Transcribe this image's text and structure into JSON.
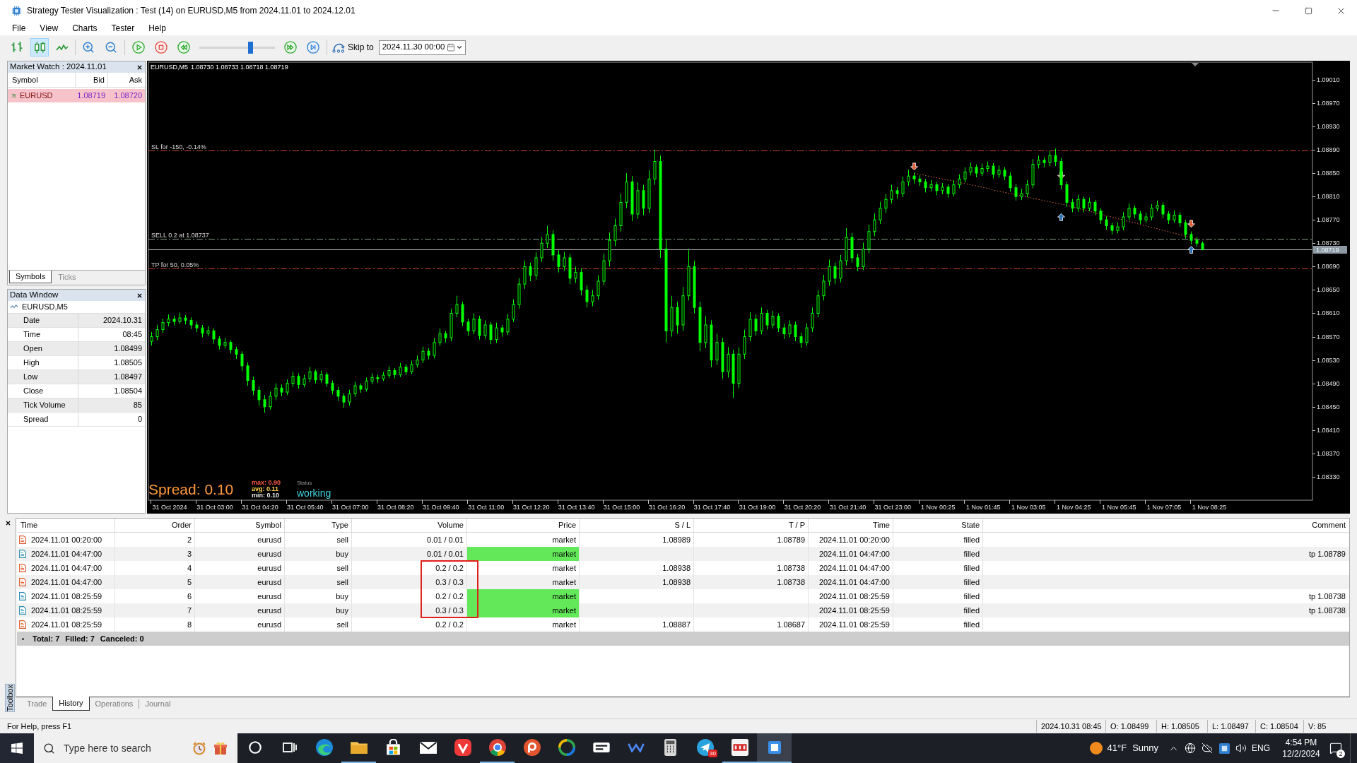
{
  "window": {
    "title": "Strategy Tester Visualization : Test (14) on EURUSD,M5 from 2024.11.01 to 2024.12.01"
  },
  "menu": [
    "File",
    "View",
    "Charts",
    "Tester",
    "Help"
  ],
  "toolbar": {
    "chart_types": [
      {
        "kind": "bars",
        "selected": false
      },
      {
        "kind": "candles",
        "selected": true
      },
      {
        "kind": "line",
        "selected": false
      }
    ],
    "speed": {
      "level": 0.67
    },
    "skip_label": "Skip to",
    "skip_date": "2024.11.30 00:00"
  },
  "market_watch": {
    "title": "Market Watch : 2024.11.01",
    "columns": [
      "Symbol",
      "Bid",
      "Ask"
    ],
    "rows": [
      {
        "symbol": "EURUSD",
        "bid": "1.08719",
        "ask": "1.08720"
      }
    ],
    "tabs": [
      {
        "label": "Symbols",
        "selected": true
      },
      {
        "label": "Ticks",
        "selected": false
      }
    ]
  },
  "data_window": {
    "title": "Data Window",
    "symbol": "EURUSD,M5",
    "rows": [
      {
        "label": "Date",
        "value": "2024.10.31"
      },
      {
        "label": "Time",
        "value": "08:45"
      },
      {
        "label": "Open",
        "value": "1.08499"
      },
      {
        "label": "High",
        "value": "1.08505"
      },
      {
        "label": "Low",
        "value": "1.08497"
      },
      {
        "label": "Close",
        "value": "1.08504"
      },
      {
        "label": "Tick Volume",
        "value": "85"
      },
      {
        "label": "Spread",
        "value": "0"
      }
    ]
  },
  "chart": {
    "header": {
      "symbol": "EURUSD,M5",
      "prices": "1.08730 1.08733 1.08718 1.08719"
    },
    "overlay": {
      "spread": "Spread: 0.10",
      "stats": [
        {
          "text": "max: 0.90",
          "color": "#ff5a4a"
        },
        {
          "text": "avg: 0.11",
          "color": "#ffd24a"
        },
        {
          "text": "min: 0.10",
          "color": "#e8e8e8"
        }
      ],
      "status_label": "Status",
      "status": "working"
    },
    "chart_data": [
      {
        "type": "candlestick",
        "color": "#00ff00",
        "categories": [
          null,
          null,
          null,
          "31 Oct 2024",
          null,
          null,
          null,
          null,
          null,
          null,
          null,
          "31 Oct 03:00",
          null,
          null,
          null,
          null,
          null,
          null,
          null,
          "31 Oct 04:20",
          null,
          null,
          null,
          null,
          null,
          null,
          null,
          "31 Oct 05:40",
          null,
          null,
          null,
          null,
          null,
          null,
          null,
          "31 Oct 07:00",
          null,
          null,
          null,
          null,
          null,
          null,
          null,
          "31 Oct 08:20",
          null,
          null,
          null,
          null,
          null,
          null,
          null,
          "31 Oct 09:40",
          null,
          null,
          null,
          null,
          null,
          null,
          null,
          "31 Oct 11:00",
          null,
          null,
          null,
          null,
          null,
          null,
          null,
          "31 Oct 12:20",
          null,
          null,
          null,
          null,
          null,
          null,
          null,
          "31 Oct 13:40",
          null,
          null,
          null,
          null,
          null,
          null,
          null,
          "31 Oct 15:00",
          null,
          null,
          null,
          null,
          null,
          null,
          null,
          "31 Oct 16:20",
          null,
          null,
          null,
          null,
          null,
          null,
          null,
          "31 Oct 17:40",
          null,
          null,
          null,
          null,
          null,
          null,
          null,
          "31 Oct 19:00",
          null,
          null,
          null,
          null,
          null,
          null,
          null,
          "31 Oct 20:20",
          null,
          null,
          null,
          null,
          null,
          null,
          null,
          "31 Oct 21:40",
          null,
          null,
          null,
          null,
          null,
          null,
          null,
          "31 Oct 23:00",
          null,
          null,
          null,
          null,
          null,
          null,
          null,
          "1 Nov 00:25",
          null,
          null,
          null,
          null,
          null,
          null,
          null,
          "1 Nov 01:45",
          null,
          null,
          null,
          null,
          null,
          null,
          null,
          "1 Nov 03:05",
          null,
          null,
          null,
          null,
          null,
          null,
          null,
          "1 Nov 04:25",
          null,
          null,
          null,
          null,
          null,
          null,
          null,
          "1 Nov 05:45",
          null,
          null,
          null,
          null,
          null,
          null,
          null,
          "1 Nov 07:05",
          null,
          null,
          null,
          null,
          null,
          null,
          null,
          "1 Nov 08:25",
          null,
          null,
          null,
          null,
          null,
          null,
          null,
          null,
          null,
          null,
          null,
          null,
          null,
          null,
          null,
          null,
          null,
          null
        ],
        "ohlc": [
          [
            1.08562,
            1.08578,
            1.08555,
            1.0857
          ],
          [
            1.0857,
            1.0859,
            1.08564,
            1.08582
          ],
          [
            1.08582,
            1.08601,
            1.08576,
            1.08594
          ],
          [
            1.08594,
            1.08608,
            1.08588,
            1.086
          ],
          [
            1.086,
            1.08606,
            1.08589,
            1.08596
          ],
          [
            1.08596,
            1.08611,
            1.08592,
            1.08602
          ],
          [
            1.08602,
            1.08607,
            1.08591,
            1.08598
          ],
          [
            1.08598,
            1.08603,
            1.08583,
            1.0859
          ],
          [
            1.0859,
            1.08596,
            1.08578,
            1.08585
          ],
          [
            1.08585,
            1.0859,
            1.08569,
            1.08576
          ],
          [
            1.08576,
            1.08588,
            1.08571,
            1.0858
          ],
          [
            1.0858,
            1.08584,
            1.08558,
            1.08566
          ],
          [
            1.08566,
            1.08571,
            1.08548,
            1.08555
          ],
          [
            1.08555,
            1.08568,
            1.0855,
            1.0856
          ],
          [
            1.0856,
            1.08564,
            1.08541,
            1.08548
          ],
          [
            1.08548,
            1.08553,
            1.08532,
            1.0854
          ],
          [
            1.0854,
            1.08545,
            1.08511,
            1.0852
          ],
          [
            1.0852,
            1.08526,
            1.08486,
            1.08495
          ],
          [
            1.08495,
            1.08502,
            1.0847,
            1.08478
          ],
          [
            1.08478,
            1.08485,
            1.08452,
            1.08462
          ],
          [
            1.08462,
            1.0847,
            1.0844,
            1.0845
          ],
          [
            1.0845,
            1.08476,
            1.08445,
            1.08468
          ],
          [
            1.08468,
            1.0849,
            1.08461,
            1.08482
          ],
          [
            1.08482,
            1.08488,
            1.08468,
            1.08475
          ],
          [
            1.08475,
            1.08497,
            1.0847,
            1.0849
          ],
          [
            1.0849,
            1.0851,
            1.08484,
            1.08502
          ],
          [
            1.08502,
            1.08507,
            1.08481,
            1.08488
          ],
          [
            1.08488,
            1.08505,
            1.08483,
            1.08498
          ],
          [
            1.08498,
            1.08518,
            1.08492,
            1.0851
          ],
          [
            1.0851,
            1.08514,
            1.0849,
            1.08496
          ],
          [
            1.08496,
            1.08512,
            1.08491,
            1.08505
          ],
          [
            1.08505,
            1.08509,
            1.08484,
            1.0849
          ],
          [
            1.0849,
            1.08495,
            1.08471,
            1.08478
          ],
          [
            1.08478,
            1.08484,
            1.0846,
            1.08468
          ],
          [
            1.08468,
            1.08473,
            1.08448,
            1.08458
          ],
          [
            1.08458,
            1.08479,
            1.08452,
            1.08472
          ],
          [
            1.08472,
            1.08493,
            1.08467,
            1.08486
          ],
          [
            1.08486,
            1.0849,
            1.08474,
            1.0848
          ],
          [
            1.0848,
            1.085,
            1.08476,
            1.08494
          ],
          [
            1.08494,
            1.08507,
            1.08489,
            1.085
          ],
          [
            1.085,
            1.08505,
            1.08491,
            1.08498
          ],
          [
            1.08498,
            1.0851,
            1.08494,
            1.08504
          ],
          [
            1.08504,
            1.08519,
            1.08499,
            1.08512
          ],
          [
            1.08512,
            1.08516,
            1.08499,
            1.08505
          ],
          [
            1.08505,
            1.08525,
            1.08501,
            1.08518
          ],
          [
            1.08518,
            1.08523,
            1.08504,
            1.0851
          ],
          [
            1.0851,
            1.08529,
            1.08506,
            1.08522
          ],
          [
            1.08522,
            1.08538,
            1.08517,
            1.0853
          ],
          [
            1.0853,
            1.08553,
            1.08525,
            1.08545
          ],
          [
            1.08545,
            1.0855,
            1.08531,
            1.08538
          ],
          [
            1.08538,
            1.08568,
            1.08533,
            1.0856
          ],
          [
            1.0856,
            1.08584,
            1.08554,
            1.08575
          ],
          [
            1.08575,
            1.0858,
            1.0856,
            1.08568
          ],
          [
            1.08568,
            1.08618,
            1.08562,
            1.0861
          ],
          [
            1.0861,
            1.0864,
            1.08603,
            1.08625
          ],
          [
            1.08625,
            1.0863,
            1.08588,
            1.08595
          ],
          [
            1.08595,
            1.08601,
            1.08572,
            1.0858
          ],
          [
            1.0858,
            1.0861,
            1.08574,
            1.086
          ],
          [
            1.086,
            1.08606,
            1.08565,
            1.08572
          ],
          [
            1.08572,
            1.08598,
            1.08566,
            1.0859
          ],
          [
            1.0859,
            1.08595,
            1.08557,
            1.08565
          ],
          [
            1.08565,
            1.08594,
            1.08559,
            1.08585
          ],
          [
            1.08585,
            1.0859,
            1.0857,
            1.08578
          ],
          [
            1.08578,
            1.08609,
            1.08573,
            1.086
          ],
          [
            1.086,
            1.08634,
            1.08595,
            1.08625
          ],
          [
            1.08625,
            1.0867,
            1.08618,
            1.0866
          ],
          [
            1.0866,
            1.087,
            1.08652,
            1.0869
          ],
          [
            1.0869,
            1.08697,
            1.08665,
            1.08675
          ],
          [
            1.08675,
            1.08714,
            1.08668,
            1.08705
          ],
          [
            1.08705,
            1.0874,
            1.08698,
            1.0873
          ],
          [
            1.0873,
            1.0876,
            1.08722,
            1.08745
          ],
          [
            1.08745,
            1.08752,
            1.087,
            1.0871
          ],
          [
            1.0871,
            1.08718,
            1.0868,
            1.0869
          ],
          [
            1.0869,
            1.08715,
            1.08683,
            1.08705
          ],
          [
            1.08705,
            1.08712,
            1.0866,
            1.0867
          ],
          [
            1.0867,
            1.0869,
            1.08662,
            1.0868
          ],
          [
            1.0868,
            1.08687,
            1.08641,
            1.0865
          ],
          [
            1.0865,
            1.08658,
            1.0862,
            1.0863
          ],
          [
            1.0863,
            1.0865,
            1.08622,
            1.0864
          ],
          [
            1.0864,
            1.08675,
            1.08633,
            1.08665
          ],
          [
            1.08665,
            1.08712,
            1.08658,
            1.087
          ],
          [
            1.087,
            1.08748,
            1.0869,
            1.08735
          ],
          [
            1.08735,
            1.08772,
            1.08725,
            1.0876
          ],
          [
            1.0876,
            1.08815,
            1.0875,
            1.088
          ],
          [
            1.088,
            1.0885,
            1.0879,
            1.08835
          ],
          [
            1.08835,
            1.08845,
            1.08768,
            1.0878
          ],
          [
            1.0878,
            1.08834,
            1.08772,
            1.0882
          ],
          [
            1.0882,
            1.0883,
            1.08778,
            1.0879
          ],
          [
            1.0879,
            1.08855,
            1.08782,
            1.0884
          ],
          [
            1.0884,
            1.0889,
            1.0883,
            1.0887
          ],
          [
            1.0887,
            1.0888,
            1.08705,
            1.0872
          ],
          [
            1.0872,
            1.08735,
            1.0856,
            1.0858
          ],
          [
            1.0858,
            1.0864,
            1.0857,
            1.0862
          ],
          [
            1.0862,
            1.0863,
            1.08575,
            1.0859
          ],
          [
            1.0859,
            1.08655,
            1.0858,
            1.0864
          ],
          [
            1.0864,
            1.0872,
            1.08632,
            1.0869
          ],
          [
            1.0869,
            1.087,
            1.0861,
            1.0862
          ],
          [
            1.0862,
            1.0863,
            1.08545,
            1.0856
          ],
          [
            1.0856,
            1.08605,
            1.0855,
            1.0859
          ],
          [
            1.0859,
            1.08598,
            1.08518,
            1.0853
          ],
          [
            1.0853,
            1.08575,
            1.08522,
            1.0856
          ],
          [
            1.0856,
            1.08568,
            1.08498,
            1.0851
          ],
          [
            1.0851,
            1.08552,
            1.085,
            1.0854
          ],
          [
            1.0854,
            1.08548,
            1.08465,
            1.0849
          ],
          [
            1.0849,
            1.08552,
            1.08482,
            1.0854
          ],
          [
            1.0854,
            1.08582,
            1.08532,
            1.0857
          ],
          [
            1.0857,
            1.08612,
            1.08562,
            1.086
          ],
          [
            1.086,
            1.08608,
            1.08572,
            1.0858
          ],
          [
            1.0858,
            1.0862,
            1.08574,
            1.0861
          ],
          [
            1.0861,
            1.08616,
            1.08582,
            1.0859
          ],
          [
            1.0859,
            1.08614,
            1.08584,
            1.08605
          ],
          [
            1.08605,
            1.0861,
            1.08578,
            1.08585
          ],
          [
            1.08585,
            1.08592,
            1.08566,
            1.08575
          ],
          [
            1.08575,
            1.08598,
            1.08569,
            1.0859
          ],
          [
            1.0859,
            1.08596,
            1.08562,
            1.0857
          ],
          [
            1.0857,
            1.08577,
            1.08551,
            1.0856
          ],
          [
            1.0856,
            1.08593,
            1.08554,
            1.08585
          ],
          [
            1.08585,
            1.0862,
            1.08578,
            1.0861
          ],
          [
            1.0861,
            1.0865,
            1.08603,
            1.0864
          ],
          [
            1.0864,
            1.08676,
            1.08632,
            1.08665
          ],
          [
            1.08665,
            1.08702,
            1.08657,
            1.0869
          ],
          [
            1.0869,
            1.08697,
            1.0866,
            1.0867
          ],
          [
            1.0867,
            1.0871,
            1.08663,
            1.087
          ],
          [
            1.087,
            1.08756,
            1.08692,
            1.0874
          ],
          [
            1.0874,
            1.08748,
            1.08697,
            1.08705
          ],
          [
            1.08705,
            1.08712,
            1.08682,
            1.0869
          ],
          [
            1.0869,
            1.08731,
            1.08684,
            1.0872
          ],
          [
            1.0872,
            1.08762,
            1.08713,
            1.0875
          ],
          [
            1.0875,
            1.08781,
            1.08742,
            1.0877
          ],
          [
            1.0877,
            1.08801,
            1.08763,
            1.0879
          ],
          [
            1.0879,
            1.08814,
            1.08782,
            1.08805
          ],
          [
            1.08805,
            1.0883,
            1.08798,
            1.0882
          ],
          [
            1.0882,
            1.08826,
            1.08806,
            1.08815
          ],
          [
            1.08815,
            1.08844,
            1.08809,
            1.08835
          ],
          [
            1.08835,
            1.08856,
            1.08828,
            1.08845
          ],
          [
            1.08845,
            1.08851,
            1.08832,
            1.0884
          ],
          [
            1.0884,
            1.08846,
            1.08828,
            1.08835
          ],
          [
            1.08835,
            1.0884,
            1.08817,
            1.08825
          ],
          [
            1.08825,
            1.08838,
            1.08819,
            1.0883
          ],
          [
            1.0883,
            1.08835,
            1.08812,
            1.0882
          ],
          [
            1.0882,
            1.08833,
            1.08814,
            1.08826
          ],
          [
            1.08826,
            1.08831,
            1.08808,
            1.08815
          ],
          [
            1.08815,
            1.08838,
            1.0881,
            1.0883
          ],
          [
            1.0883,
            1.08848,
            1.08824,
            1.0884
          ],
          [
            1.0884,
            1.0886,
            1.08834,
            1.08852
          ],
          [
            1.08852,
            1.08868,
            1.08846,
            1.0886
          ],
          [
            1.0886,
            1.08865,
            1.08843,
            1.0885
          ],
          [
            1.0885,
            1.08866,
            1.08845,
            1.08858
          ],
          [
            1.08858,
            1.0887,
            1.08852,
            1.08862
          ],
          [
            1.08862,
            1.08867,
            1.08841,
            1.08848
          ],
          [
            1.08848,
            1.08863,
            1.08842,
            1.08855
          ],
          [
            1.08855,
            1.0886,
            1.08838,
            1.08845
          ],
          [
            1.08845,
            1.08851,
            1.08818,
            1.08825
          ],
          [
            1.08825,
            1.08831,
            1.08803,
            1.0881
          ],
          [
            1.0881,
            1.08823,
            1.08804,
            1.08815
          ],
          [
            1.08815,
            1.08838,
            1.08809,
            1.0883
          ],
          [
            1.0883,
            1.08874,
            1.08824,
            1.08865
          ],
          [
            1.08865,
            1.0888,
            1.08858,
            1.08872
          ],
          [
            1.08872,
            1.08877,
            1.0886,
            1.08868
          ],
          [
            1.08868,
            1.08888,
            1.08862,
            1.0888
          ],
          [
            1.0888,
            1.08892,
            1.08862,
            1.0887
          ],
          [
            1.0887,
            1.08876,
            1.08822,
            1.0883
          ],
          [
            1.0883,
            1.08836,
            1.08792,
            1.088
          ],
          [
            1.088,
            1.08806,
            1.08783,
            1.0879
          ],
          [
            1.0879,
            1.08813,
            1.08784,
            1.08805
          ],
          [
            1.08805,
            1.0881,
            1.08783,
            1.0879
          ],
          [
            1.0879,
            1.08808,
            1.08785,
            1.088
          ],
          [
            1.088,
            1.08804,
            1.08778,
            1.08785
          ],
          [
            1.08785,
            1.0879,
            1.08763,
            1.0877
          ],
          [
            1.0877,
            1.08776,
            1.08753,
            1.0876
          ],
          [
            1.0876,
            1.08765,
            1.08745,
            1.08752
          ],
          [
            1.08752,
            1.08766,
            1.08747,
            1.08758
          ],
          [
            1.08758,
            1.08783,
            1.08752,
            1.08775
          ],
          [
            1.08775,
            1.08798,
            1.08769,
            1.0879
          ],
          [
            1.0879,
            1.08795,
            1.08773,
            1.0878
          ],
          [
            1.0878,
            1.08785,
            1.08763,
            1.0877
          ],
          [
            1.0877,
            1.08782,
            1.08765,
            1.08775
          ],
          [
            1.08775,
            1.08797,
            1.08769,
            1.0879
          ],
          [
            1.0879,
            1.08803,
            1.08785,
            1.08795
          ],
          [
            1.08795,
            1.088,
            1.08773,
            1.0878
          ],
          [
            1.0878,
            1.08785,
            1.08763,
            1.0877
          ],
          [
            1.0877,
            1.08786,
            1.08765,
            1.08778
          ],
          [
            1.08778,
            1.08783,
            1.08758,
            1.08765
          ],
          [
            1.08765,
            1.0877,
            1.08738,
            1.08745
          ],
          [
            1.08745,
            1.0875,
            1.08728,
            1.08735
          ],
          [
            1.08735,
            1.08741,
            1.08724,
            1.0873
          ],
          [
            1.0873,
            1.08733,
            1.08718,
            1.08719
          ],
          null,
          null,
          null,
          null,
          null,
          null,
          null,
          null,
          null,
          null,
          null,
          null,
          null,
          null,
          null,
          null,
          null,
          null,
          null
        ],
        "ylim": [
          1.0829,
          1.0904
        ],
        "yticks": [
          {
            "value": 1.0901,
            "label": "1.09010"
          },
          {
            "value": 1.0897,
            "label": "1.08970"
          },
          {
            "value": 1.0893,
            "label": "1.08930"
          },
          {
            "value": 1.0889,
            "label": "1.08890"
          },
          {
            "value": 1.0885,
            "label": "1.08850"
          },
          {
            "value": 1.0881,
            "label": "1.08810"
          },
          {
            "value": 1.0877,
            "label": "1.08770"
          },
          {
            "value": 1.0873,
            "label": "1.08730"
          },
          {
            "value": 1.0869,
            "label": "1.08690"
          },
          {
            "value": 1.0865,
            "label": "1.08650"
          },
          {
            "value": 1.0861,
            "label": "1.08610"
          },
          {
            "value": 1.0857,
            "label": "1.08570"
          },
          {
            "value": 1.0853,
            "label": "1.08530"
          },
          {
            "value": 1.0849,
            "label": "1.08490"
          },
          {
            "value": 1.0845,
            "label": "1.08450"
          },
          {
            "value": 1.0841,
            "label": "1.08410"
          },
          {
            "value": 1.0837,
            "label": "1.08370"
          },
          {
            "value": 1.0833,
            "label": "1.08330"
          }
        ],
        "ref_lines": [
          {
            "axis": "y",
            "value": 1.08889,
            "label": "SL for -150, -0.14%",
            "color": "#c8442c",
            "line_style": "dashdot"
          },
          {
            "axis": "y",
            "value": 1.08737,
            "label": "SELL 0.2 at 1.08737",
            "color": "#8a9f8a",
            "line_style": "dashdot"
          },
          {
            "axis": "y",
            "value": 1.08719,
            "label": "1.08719",
            "color": "#b4b4b4",
            "line_style": "solid"
          },
          {
            "axis": "y",
            "value": 1.08687,
            "label": "TP for 50, 0.05%",
            "color": "#c8442c",
            "line_style": "dashdot"
          }
        ],
        "series": [
          {
            "type": "line",
            "line_style": "dotted",
            "color": "#e06a4a",
            "values": [
              null,
              null,
              null,
              null,
              null,
              null,
              null,
              null,
              null,
              null,
              null,
              null,
              null,
              null,
              null,
              null,
              null,
              null,
              null,
              null,
              null,
              null,
              null,
              null,
              null,
              null,
              null,
              null,
              null,
              null,
              null,
              null,
              null,
              null,
              null,
              null,
              null,
              null,
              null,
              null,
              null,
              null,
              null,
              null,
              null,
              null,
              null,
              null,
              null,
              null,
              null,
              null,
              null,
              null,
              null,
              null,
              null,
              null,
              null,
              null,
              null,
              null,
              null,
              null,
              null,
              null,
              null,
              null,
              null,
              null,
              null,
              null,
              null,
              null,
              null,
              null,
              null,
              null,
              null,
              null,
              null,
              null,
              null,
              null,
              null,
              null,
              null,
              null,
              null,
              null,
              null,
              null,
              null,
              null,
              null,
              null,
              null,
              null,
              null,
              null,
              null,
              null,
              null,
              null,
              null,
              null,
              null,
              null,
              null,
              null,
              null,
              null,
              null,
              null,
              null,
              null,
              null,
              null,
              null,
              null,
              null,
              null,
              null,
              null,
              null,
              null,
              null,
              null,
              null,
              null,
              null,
              null,
              null,
              null,
              null,
              1.0885,
              1.08848,
              1.08846,
              1.08844,
              1.08842,
              1.0884,
              1.08838,
              1.08836,
              1.08834,
              1.08832,
              1.0883,
              1.08828,
              1.08826,
              1.08824,
              1.08821,
              1.08819,
              1.08817,
              1.08815,
              1.08813,
              1.08811,
              1.08809,
              1.08807,
              1.08805,
              1.08803,
              1.08801,
              1.08799,
              1.08797,
              1.08795,
              1.08792,
              1.0879,
              1.08787,
              1.08785,
              1.08782,
              1.0878,
              1.08777,
              1.08775,
              1.08772,
              1.0877,
              1.08767,
              1.08765,
              1.08762,
              1.0876,
              1.08757,
              1.08755,
              1.08752,
              1.0875,
              1.08747,
              1.08745,
              1.08742,
              1.0874,
              1.08737,
              null,
              null,
              null,
              null,
              null,
              null,
              null,
              null,
              null,
              null,
              null,
              null,
              null,
              null,
              null,
              null,
              null,
              null,
              null,
              null
            ]
          }
        ]
      }
    ]
  },
  "toolbox": {
    "side_label": "Toolbox",
    "columns": [
      "Time",
      "Order",
      "Symbol",
      "Type",
      "Volume",
      "Price",
      "S / L",
      "T / P",
      "Time",
      "State",
      "Comment"
    ],
    "orders": [
      {
        "kind": "sell",
        "time": "2024.11.01 00:20:00",
        "order": "2",
        "symbol": "eurusd",
        "type": "sell",
        "volume": "0.01 / 0.01",
        "price": "market",
        "price_highlight": false,
        "sl": "1.08989",
        "tp": "1.08789",
        "done_time": "2024.11.01 00:20:00",
        "state": "filled",
        "boxed": false
      },
      {
        "kind": "buy",
        "time": "2024.11.01 04:47:00",
        "order": "3",
        "symbol": "eurusd",
        "type": "buy",
        "volume": "0.01 / 0.01",
        "price": "market",
        "price_highlight": true,
        "done_time": "2024.11.01 04:47:00",
        "state": "filled",
        "comment": "tp 1.08789",
        "boxed": false
      },
      {
        "kind": "sell",
        "time": "2024.11.01 04:47:00",
        "order": "4",
        "symbol": "eurusd",
        "type": "sell",
        "volume": "0.2 / 0.2",
        "price": "market",
        "price_highlight": false,
        "sl": "1.08938",
        "tp": "1.08738",
        "done_time": "2024.11.01 04:47:00",
        "state": "filled",
        "boxed": true
      },
      {
        "kind": "sell",
        "time": "2024.11.01 04:47:00",
        "order": "5",
        "symbol": "eurusd",
        "type": "sell",
        "volume": "0.3 / 0.3",
        "price": "market",
        "price_highlight": false,
        "sl": "1.08938",
        "tp": "1.08738",
        "done_time": "2024.11.01 04:47:00",
        "state": "filled",
        "boxed": true
      },
      {
        "kind": "buy",
        "time": "2024.11.01 08:25:59",
        "order": "6",
        "symbol": "eurusd",
        "type": "buy",
        "volume": "0.2 / 0.2",
        "price": "market",
        "price_highlight": true,
        "done_time": "2024.11.01 08:25:59",
        "state": "filled",
        "comment": "tp 1.08738",
        "boxed": true
      },
      {
        "kind": "buy",
        "time": "2024.11.01 08:25:59",
        "order": "7",
        "symbol": "eurusd",
        "type": "buy",
        "volume": "0.3 / 0.3",
        "price": "market",
        "price_highlight": true,
        "done_time": "2024.11.01 08:25:59",
        "state": "filled",
        "comment": "tp 1.08738",
        "boxed": true
      },
      {
        "kind": "sell",
        "time": "2024.11.01 08:25:59",
        "order": "8",
        "symbol": "eurusd",
        "type": "sell",
        "volume": "0.2 / 0.2",
        "price": "market",
        "price_highlight": false,
        "sl": "1.08887",
        "tp": "1.08687",
        "done_time": "2024.11.01 08:25:59",
        "state": "filled",
        "boxed": false
      }
    ],
    "summary": [
      "Total: 7",
      "Filled: 7",
      "Canceled: 0"
    ],
    "tabs": [
      {
        "label": "Trade",
        "selected": false
      },
      {
        "label": "History",
        "selected": true
      },
      {
        "label": "Operations",
        "selected": false
      },
      {
        "label": "Journal",
        "selected": false
      }
    ]
  },
  "status_bar": {
    "help": "For Help, press F1",
    "fields": [
      "2024.10.31 08:45",
      "O: 1.08499",
      "H: 1.08505",
      "L: 1.08497",
      "C: 1.08504",
      "V: 85"
    ]
  },
  "taskbar": {
    "search": {
      "placeholder": "Type here to search"
    },
    "apps": [
      {
        "kind": "ring",
        "running": false,
        "active": false
      },
      {
        "kind": "task_view",
        "running": false,
        "active": false
      },
      {
        "kind": "swirl",
        "running": false,
        "active": false
      },
      {
        "kind": "folder",
        "running": true,
        "active": false
      },
      {
        "kind": "bag",
        "running": false,
        "active": false
      },
      {
        "kind": "envelope",
        "running": false,
        "active": false
      },
      {
        "kind": "v_logo",
        "running": false,
        "active": false
      },
      {
        "kind": "segmented_circle",
        "running": true,
        "active": false
      },
      {
        "kind": "p_logo",
        "running": false,
        "active": false
      },
      {
        "kind": "globe",
        "running": false,
        "active": false
      },
      {
        "kind": "tv_logo",
        "running": false,
        "active": false
      },
      {
        "kind": "w_logo",
        "running": false,
        "active": false
      },
      {
        "kind": "calculator",
        "running": false,
        "active": false
      },
      {
        "kind": "paper_plane",
        "running": false,
        "active": false,
        "badge": "30"
      },
      {
        "kind": "grid_tile",
        "running": true,
        "active": false
      },
      {
        "kind": "square_tile",
        "running": true,
        "active": true
      }
    ],
    "weather": {
      "temperature": "41°F",
      "condition": "Sunny"
    },
    "language": "ENG",
    "time": "4:54 PM",
    "date": "12/2/2024",
    "notifications": "2"
  }
}
